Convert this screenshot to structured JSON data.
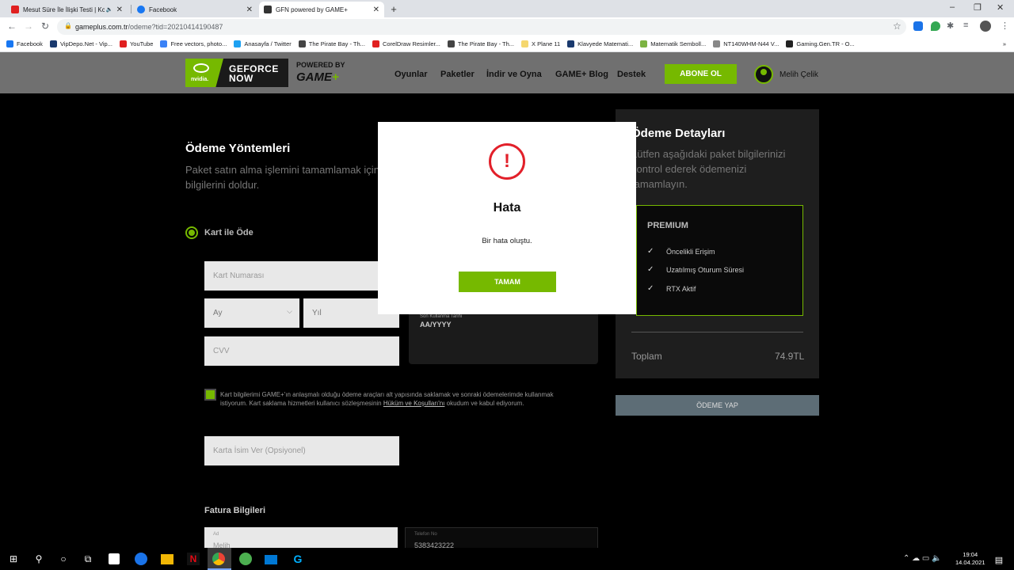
{
  "browser": {
    "tabs": [
      {
        "title": "Mesut Süre İle İlişki Testi | Kc",
        "color": "#e02020"
      },
      {
        "title": "Facebook",
        "color": "#1877f2"
      },
      {
        "title": "GFN powered by GAME+",
        "color": "#333333"
      }
    ],
    "window_controls": {
      "minimize": "–",
      "restore": "❐",
      "close": "✕"
    },
    "url_host": "gameplus.com.tr",
    "url_path": "/odeme?tid=20210414190487",
    "bookmarks": [
      {
        "label": "Facebook",
        "color": "#1877f2"
      },
      {
        "label": "VipDepo.Net - Vip...",
        "color": "#1a3a6e"
      },
      {
        "label": "YouTube",
        "color": "#e02020"
      },
      {
        "label": "Free vectors, photo...",
        "color": "#3b82f6"
      },
      {
        "label": "Anasayfa / Twitter",
        "color": "#1da1f2"
      },
      {
        "label": "The Pirate Bay - Th...",
        "color": "#444444"
      },
      {
        "label": "CorelDraw Resimler...",
        "color": "#e02020"
      },
      {
        "label": "The Pirate Bay - Th...",
        "color": "#444444"
      },
      {
        "label": "X Plane 11",
        "color": "#f5d76e"
      },
      {
        "label": "Klavyede Matemati...",
        "color": "#1a3a6e"
      },
      {
        "label": "Matematik Semboll...",
        "color": "#7cb342"
      },
      {
        "label": "NT140WHM-N44 V...",
        "color": "#888888"
      },
      {
        "label": "Gaming.Gen.TR - O...",
        "color": "#222222"
      }
    ],
    "more_bookmarks": "»"
  },
  "site": {
    "logo": {
      "nvidia": "nvidia.",
      "line1": "GEFORCE",
      "line2": "NOW",
      "powered": "POWERED BY",
      "game": "GAME",
      "plus": "+"
    },
    "nav": [
      "Oyunlar",
      "Paketler",
      "İndir ve Oyna",
      "GAME+ Blog",
      "Destek"
    ],
    "subscribe_label": "ABONE OL",
    "username": "Melih Çelik"
  },
  "payment": {
    "title": "Ödeme Yöntemleri",
    "subtitle": "Paket satın alma işlemini tamamlamak için bilgilerini doldur.",
    "method_label": "Kart ile Öde",
    "card_number_placeholder": "Kart Numarası",
    "month_placeholder": "Ay",
    "year_placeholder": "Yıl",
    "cvv_placeholder": "CVV",
    "expiry_label": "Son Kullanma Tarihi",
    "expiry_value": "AA/YYYY",
    "consent_text": "Kart bilgilerimi GAME+'ın anlaşmalı olduğu ödeme araçları alt yapısında saklamak ve sonraki ödemelerimde kullanmak istiyorum. Kart saklama hizmetleri kullanıcı sözleşmesinin ",
    "consent_link": "Hüküm ve Koşulları'nı",
    "consent_tail": " okudum ve kabul ediyorum.",
    "card_name_placeholder": "Karta İsim Ver (Opsiyonel)",
    "billing_title": "Fatura Bilgileri",
    "billing_name_label": "Ad",
    "billing_name_value": "Melih",
    "billing_phone_label": "Telefon No",
    "billing_phone_value": "5383423222"
  },
  "summary": {
    "title": "Ödeme Detayları",
    "subtitle": "Lütfen aşağıdaki paket bilgilerinizi kontrol ederek ödemenizi tamamlayın.",
    "package_name": "PREMIUM",
    "features": [
      "Öncelikli Erişim",
      "Uzatılmış Oturum Süresi",
      "RTX Aktif"
    ],
    "total_label": "Toplam",
    "total_value": "74.9TL",
    "pay_button": "ÖDEME YAP"
  },
  "modal": {
    "icon": "!",
    "title": "Hata",
    "message": "Bir hata oluştu.",
    "ok_label": "TAMAM"
  },
  "taskbar": {
    "time": "19:04",
    "date": "14.04.2021"
  }
}
